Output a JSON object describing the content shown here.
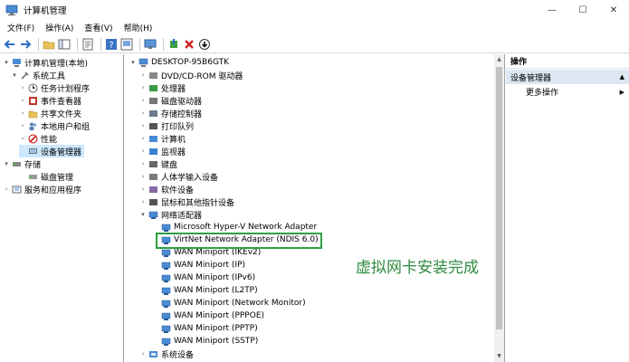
{
  "window": {
    "title": "计算机管理",
    "min": "—",
    "max": "☐",
    "close": "✕"
  },
  "menu": [
    "文件(F)",
    "操作(A)",
    "查看(V)",
    "帮助(H)"
  ],
  "left_tree": {
    "root": "计算机管理(本地)",
    "system_tools": "系统工具",
    "task_scheduler": "任务计划程序",
    "event_viewer": "事件查看器",
    "shared_folders": "共享文件夹",
    "local_users": "本地用户和组",
    "performance": "性能",
    "device_manager": "设备管理器",
    "storage": "存储",
    "disk_management": "磁盘管理",
    "services_apps": "服务和应用程序"
  },
  "device_tree": {
    "computer": "DESKTOP-95B6GTK",
    "categories_top": [
      "DVD/CD-ROM 驱动器",
      "处理器",
      "磁盘驱动器",
      "存储控制器",
      "打印队列",
      "计算机",
      "监视器",
      "键盘",
      "人体学输入设备",
      "软件设备",
      "鼠标和其他指针设备"
    ],
    "network_category": "网络适配器",
    "network_adapters": [
      "Microsoft Hyper-V Network Adapter",
      "VirtNet Network Adapter (NDIS 6.0)",
      "WAN Miniport (IKEv2)",
      "WAN Miniport (IP)",
      "WAN Miniport (IPv6)",
      "WAN Miniport (L2TP)",
      "WAN Miniport (Network Monitor)",
      "WAN Miniport (PPPOE)",
      "WAN Miniport (PPTP)",
      "WAN Miniport (SSTP)"
    ],
    "last_category": "系统设备"
  },
  "annotation": "虚拟网卡安装完成",
  "actions": {
    "header": "操作",
    "section": "设备管理器",
    "more": "更多操作"
  },
  "colors": {
    "highlight_border": "#2ea043",
    "annotation_text": "#2e8b3f",
    "selection": "#cce8ff",
    "actions_section_bg": "#dde7f3"
  }
}
